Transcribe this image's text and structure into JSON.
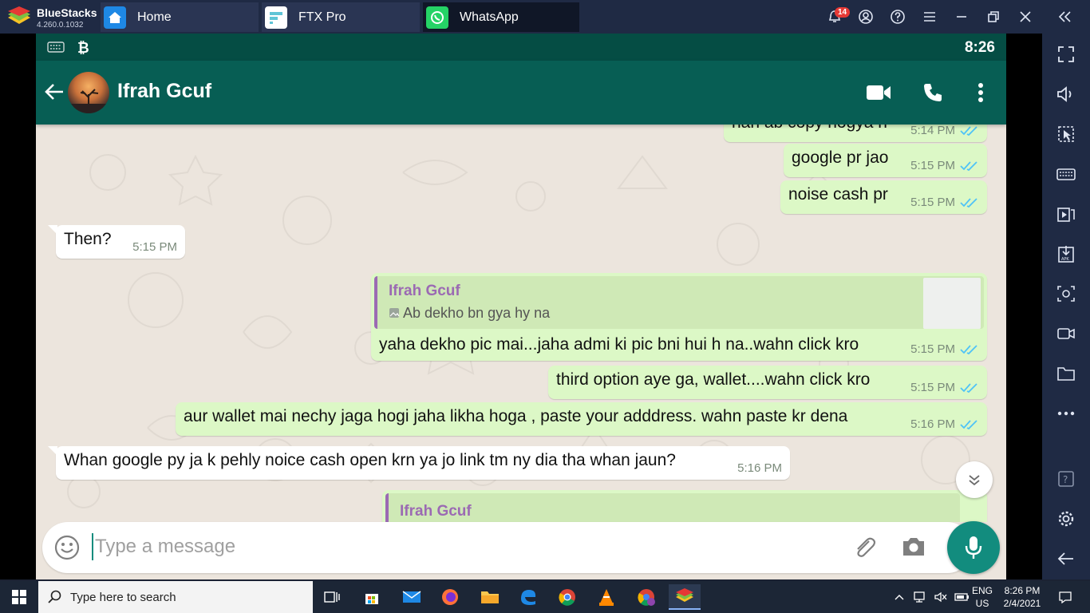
{
  "bluestacks": {
    "brand": "BlueStacks",
    "version": "4.260.0.1032",
    "tabs": [
      {
        "label": "Home",
        "icon": "home-icon"
      },
      {
        "label": "FTX Pro",
        "icon": "ftx-icon"
      },
      {
        "label": "WhatsApp",
        "icon": "whatsapp-icon"
      }
    ],
    "notification_count": "14",
    "controls": [
      "bell-icon",
      "account-icon",
      "help-icon",
      "menu-icon",
      "minimize-icon",
      "restore-icon",
      "close-icon",
      "collapse-sidebar-icon"
    ],
    "sidebar": [
      "fullscreen-icon",
      "volume-icon",
      "pointer-icon",
      "keyboard-icon",
      "media-manager-icon",
      "apk-install-icon",
      "screenshot-icon",
      "record-icon",
      "folder-icon",
      "more-icon",
      "help-icon",
      "settings-icon",
      "back-icon"
    ]
  },
  "android": {
    "status_time": "8:26"
  },
  "chat": {
    "contact_name": "Ifrah Gcuf",
    "messages": [
      {
        "dir": "out",
        "text": "nah ab copy hogya h",
        "time": "5:14 PM"
      },
      {
        "dir": "out",
        "text": "google pr jao",
        "time": "5:15 PM"
      },
      {
        "dir": "out",
        "text": "noise cash pr",
        "time": "5:15 PM"
      },
      {
        "dir": "in",
        "text": "Then?",
        "time": "5:15 PM"
      },
      {
        "dir": "out",
        "quote_name": "Ifrah Gcuf",
        "quote_text": "Ab dekho bn gya hy na",
        "text": "yaha dekho pic mai...jaha admi ki pic bni hui h na..wahn click kro",
        "time": "5:15 PM"
      },
      {
        "dir": "out",
        "text": "third option aye ga, wallet....wahn click kro",
        "time": "5:15 PM"
      },
      {
        "dir": "out",
        "text": "aur wallet mai nechy jaga hogi jaha likha hoga , paste your adddress. wahn paste kr dena",
        "time": "5:16 PM"
      },
      {
        "dir": "in",
        "text": "Whan google py ja k pehly noice cash open krn ya jo link tm ny dia tha whan jaun?",
        "time": "5:16 PM"
      },
      {
        "dir": "out",
        "quote_name": "Ifrah Gcuf"
      }
    ],
    "input_placeholder": "Type a message"
  },
  "taskbar": {
    "search_placeholder": "Type here to search",
    "lang_top": "ENG",
    "lang_bottom": "US",
    "time": "8:26 PM",
    "date": "2/4/2021"
  },
  "colors": {
    "wa_header": "#075e54",
    "wa_status": "#054d44",
    "out_bubble": "#dcf8c6",
    "in_bubble": "#ffffff",
    "accent": "#128c7e",
    "quote_name": "#9b6ab3",
    "tick_blue": "#4fc3f7"
  }
}
